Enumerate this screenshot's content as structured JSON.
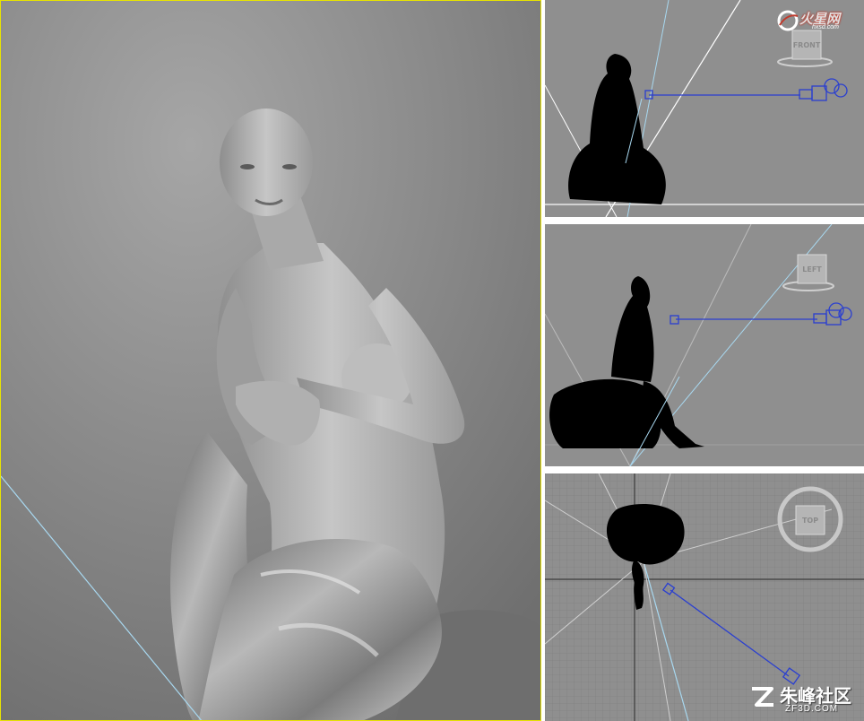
{
  "viewports": {
    "perspective": {
      "active": true,
      "border_color": "#e8e400"
    },
    "front": {
      "nav_cube_label": "FRONT"
    },
    "left": {
      "nav_cube_label": "LEFT"
    },
    "top": {
      "nav_cube_label": "TOP"
    }
  },
  "watermarks": {
    "top_right_logo": "火星网",
    "top_right_url": "hxsd.com",
    "bottom_right_name": "朱峰社区",
    "bottom_right_url": "ZF3D.COM"
  },
  "colors": {
    "viewport_bg": "#8f8f8f",
    "silhouette": "#000000",
    "camera": "#2a3fd0",
    "light_cone": "#a8d8f0",
    "grid": "#7a7a7a"
  },
  "icons": [
    "camera-icon",
    "target-icon",
    "nav-cube-icon",
    "logo-icon"
  ]
}
